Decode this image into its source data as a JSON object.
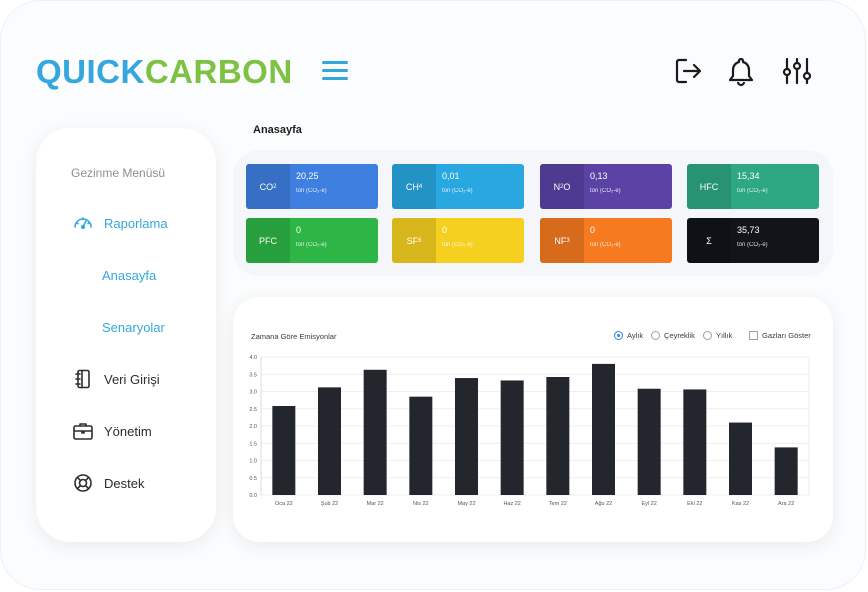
{
  "brand": {
    "part1": "QUICK",
    "part2": "CARBON",
    "color1": "#35a7dc",
    "color2": "#7dc242"
  },
  "header": {
    "icons": [
      "logout-icon",
      "bell-icon",
      "sliders-icon"
    ]
  },
  "sidebar": {
    "title": "Gezinme Menüsü",
    "items": [
      {
        "label": "Raporlama",
        "icon": "gauge-icon"
      },
      {
        "label": "Anasayfa"
      },
      {
        "label": "Senaryolar"
      },
      {
        "label": "Veri Girişi",
        "icon": "notebook-icon"
      },
      {
        "label": "Yönetim",
        "icon": "briefcase-icon"
      },
      {
        "label": "Destek",
        "icon": "lifebuoy-icon"
      }
    ]
  },
  "page_title": "Anasayfa",
  "cards": [
    {
      "gas": "CO",
      "sub": "2",
      "value": "20,25",
      "unit": "ton (CO₂-e)",
      "color": "#3f7fe0"
    },
    {
      "gas": "CH",
      "sub": "4",
      "value": "0,01",
      "unit": "ton (CO₂-e)",
      "color": "#28a7e0"
    },
    {
      "gas": "N",
      "sub": "2",
      "gas2": "O",
      "value": "0,13",
      "unit": "ton (CO₂-e)",
      "color": "#5b43a6"
    },
    {
      "gas": "HFC",
      "value": "15,34",
      "unit": "ton (CO₂-e)",
      "color": "#2da880"
    },
    {
      "gas": "PFC",
      "value": "0",
      "unit": "ton (CO₂-e)",
      "color": "#2db545"
    },
    {
      "gas": "SF",
      "sub": "6",
      "value": "0",
      "unit": "ton (CO₂-e)",
      "color": "#f5d020"
    },
    {
      "gas": "NF",
      "sub": "3",
      "value": "0",
      "unit": "ton (CO₂-e)",
      "color": "#f57a20"
    },
    {
      "gas": "Σ",
      "value": "35,73",
      "unit": "ton (CO₂-e)",
      "color": "#111418"
    }
  ],
  "chart_controls": {
    "options": [
      "Aylık",
      "Çeyreklik",
      "Yıllık"
    ],
    "selected": "Aylık",
    "checkbox_label": "Gazları Göster"
  },
  "chart_data": {
    "type": "bar",
    "title": "Zamana Göre Emisyonlar",
    "categories": [
      "Oca 22",
      "Şub 22",
      "Mar 22",
      "Nis 22",
      "May 22",
      "Haz 22",
      "Tem 22",
      "Ağu 22",
      "Eyl 22",
      "Ekl 22",
      "Kas 22",
      "Ara 22"
    ],
    "values": [
      2.58,
      3.12,
      3.63,
      2.85,
      3.39,
      3.32,
      3.42,
      3.8,
      3.08,
      3.06,
      2.1,
      1.38
    ],
    "yticks": [
      "0.0",
      "0.5",
      "1.0",
      "1.5",
      "2.0",
      "2.5",
      "3.0",
      "3.5",
      "4.0"
    ],
    "ylim": [
      0,
      4
    ],
    "grid": true,
    "bar_color": "#23272d"
  }
}
